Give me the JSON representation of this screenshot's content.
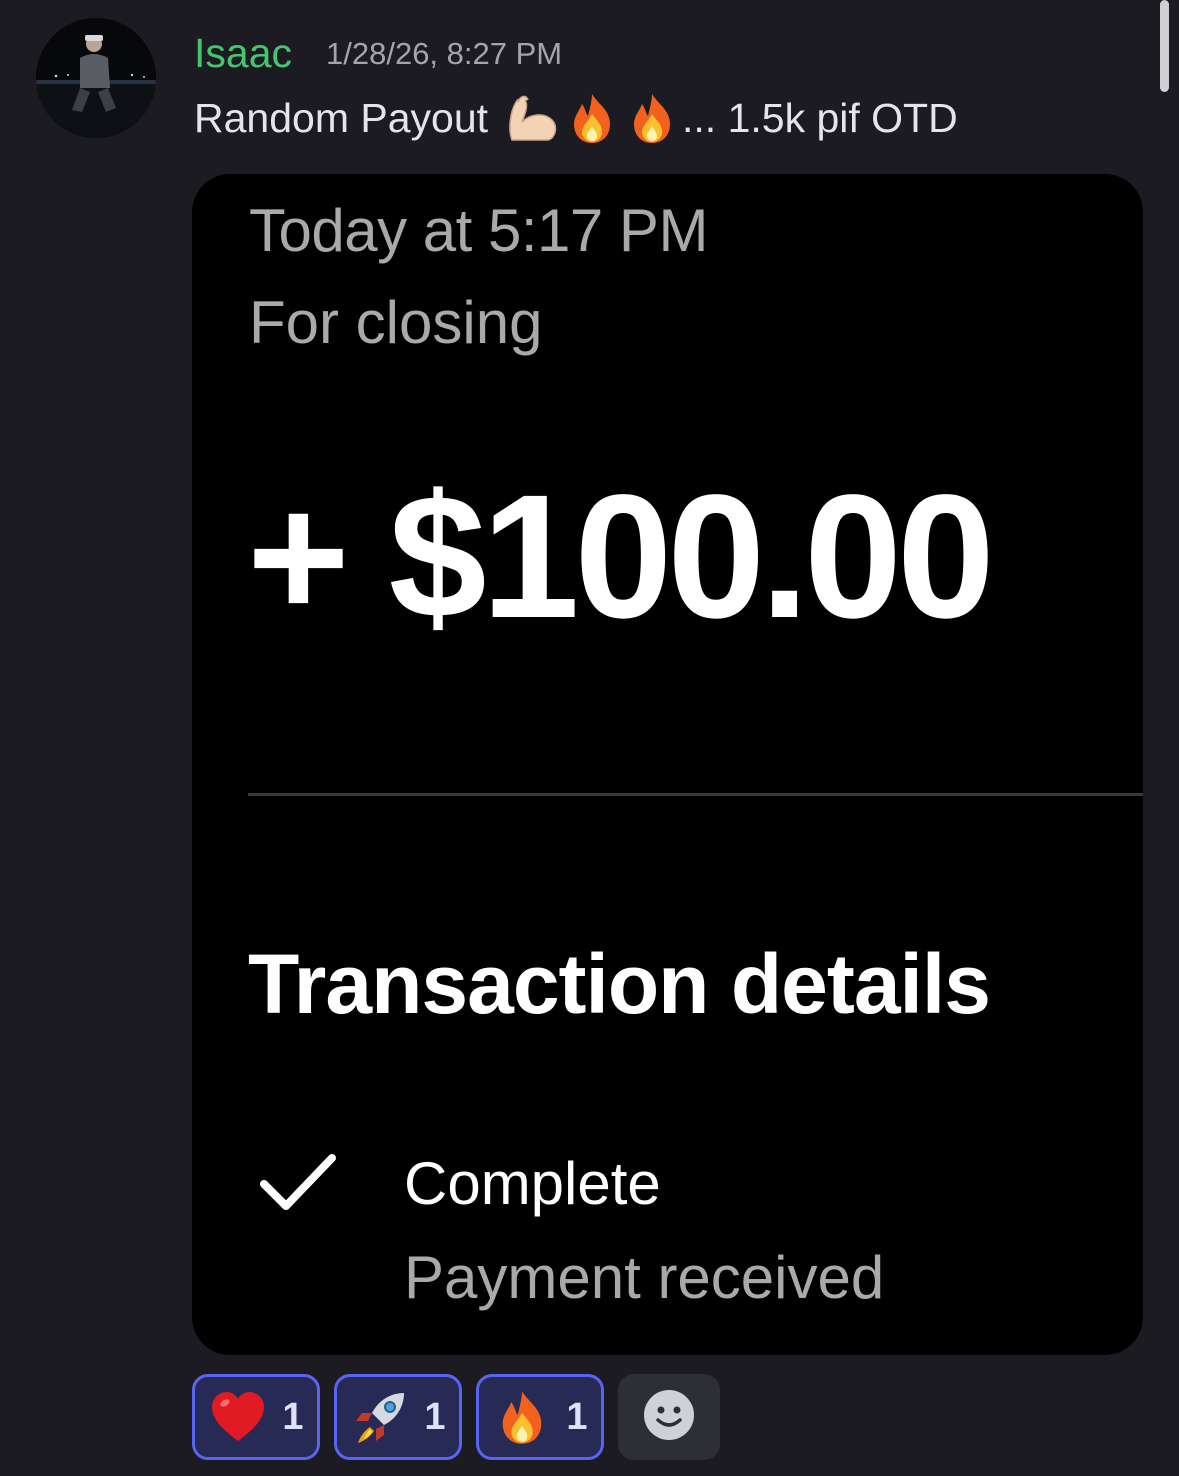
{
  "author": {
    "name": "Isaac",
    "timestamp": "1/28/26, 8:27 PM"
  },
  "message": {
    "text_before": "Random Payout",
    "emojis": [
      "flexed-biceps",
      "fire",
      "fire"
    ],
    "text_after": "... 1.5k pif OTD"
  },
  "attachment": {
    "date": "Today at 5:17 PM",
    "memo": "For closing",
    "amount": "+ $100.00",
    "section_title": "Transaction details",
    "status_title": "Complete",
    "status_subtitle": "Payment received"
  },
  "reactions": [
    {
      "emoji": "heart",
      "count": "1"
    },
    {
      "emoji": "rocket",
      "count": "1"
    },
    {
      "emoji": "fire",
      "count": "1"
    }
  ],
  "colors": {
    "background": "#1b1b21",
    "username": "#46c46f",
    "reaction_border": "#5865f2",
    "reaction_fill": "#262a55"
  }
}
